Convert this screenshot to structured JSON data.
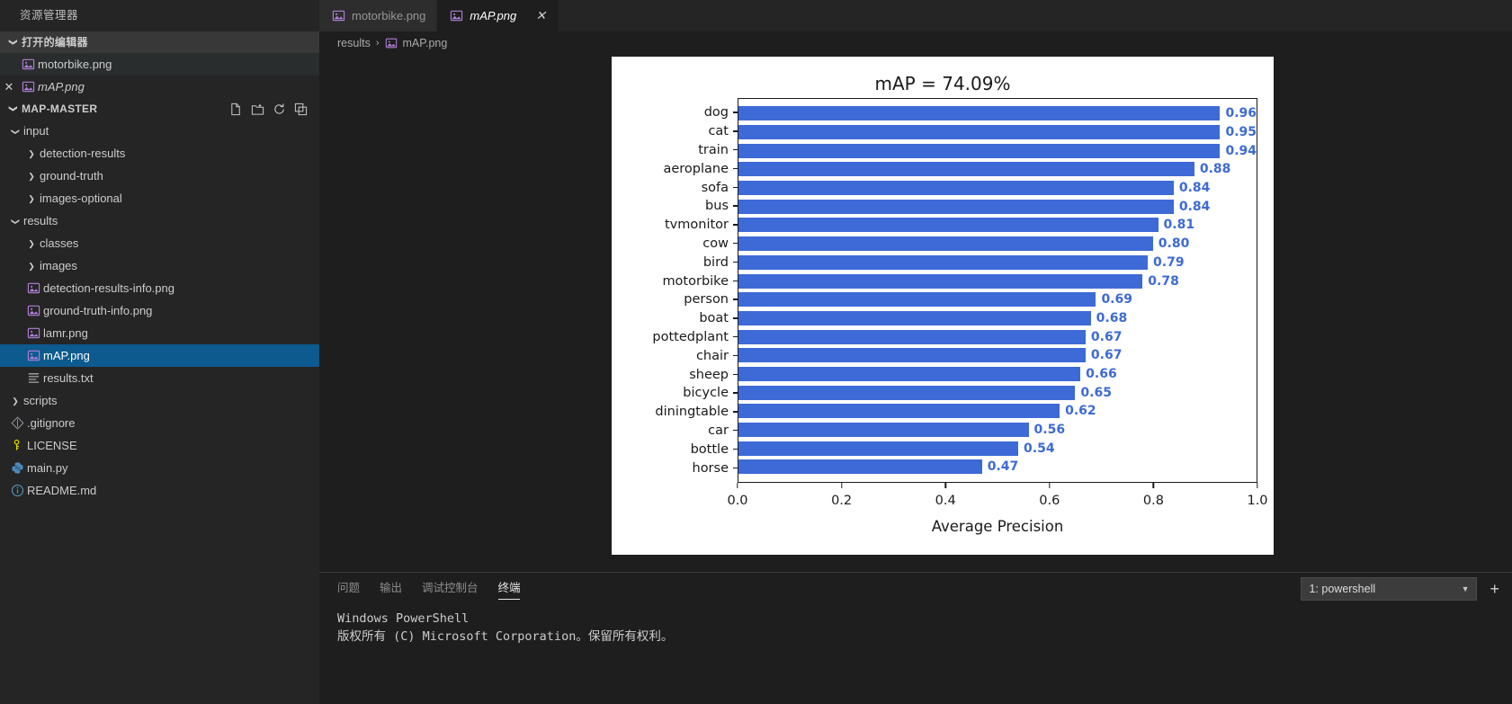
{
  "sidebar": {
    "title": "资源管理器",
    "open_editors": {
      "label": "打开的编辑器",
      "items": [
        {
          "name": "motorbike.png",
          "icon": "image-file-icon",
          "closable": false
        },
        {
          "name": "mAP.png",
          "icon": "image-file-icon",
          "closable": true,
          "active": true
        }
      ]
    },
    "project": {
      "label": "MAP-MASTER",
      "actions": [
        "new-file-icon",
        "new-folder-icon",
        "refresh-icon",
        "collapse-all-icon"
      ],
      "tree": [
        {
          "label": "input",
          "type": "folder",
          "state": "expanded",
          "depth": 1
        },
        {
          "label": "detection-results",
          "type": "folder",
          "state": "collapsed",
          "depth": 2
        },
        {
          "label": "ground-truth",
          "type": "folder",
          "state": "collapsed",
          "depth": 2
        },
        {
          "label": "images-optional",
          "type": "folder",
          "state": "collapsed",
          "depth": 2
        },
        {
          "label": "results",
          "type": "folder",
          "state": "expanded",
          "depth": 1
        },
        {
          "label": "classes",
          "type": "folder",
          "state": "collapsed",
          "depth": 2
        },
        {
          "label": "images",
          "type": "folder",
          "state": "collapsed",
          "depth": 2
        },
        {
          "label": "detection-results-info.png",
          "type": "image",
          "depth": 2
        },
        {
          "label": "ground-truth-info.png",
          "type": "image",
          "depth": 2
        },
        {
          "label": "lamr.png",
          "type": "image",
          "depth": 2
        },
        {
          "label": "mAP.png",
          "type": "image",
          "depth": 2,
          "selected": true
        },
        {
          "label": "results.txt",
          "type": "text",
          "depth": 2
        },
        {
          "label": "scripts",
          "type": "folder",
          "state": "collapsed",
          "depth": 1
        },
        {
          "label": ".gitignore",
          "type": "git",
          "depth": 1
        },
        {
          "label": "LICENSE",
          "type": "license",
          "depth": 1
        },
        {
          "label": "main.py",
          "type": "python",
          "depth": 1
        },
        {
          "label": "README.md",
          "type": "info",
          "depth": 1
        }
      ]
    }
  },
  "tabs": [
    {
      "label": "motorbike.png",
      "active": false,
      "closable": false
    },
    {
      "label": "mAP.png",
      "active": true,
      "closable": true
    }
  ],
  "breadcrumb": {
    "parts": [
      "results",
      "mAP.png"
    ],
    "separator": "›"
  },
  "chart_data": {
    "type": "bar",
    "orientation": "horizontal",
    "title": "mAP = 74.09%",
    "xlabel": "Average Precision",
    "ylabel": "",
    "xlim": [
      0.0,
      1.0
    ],
    "xticks": [
      0.0,
      0.2,
      0.4,
      0.6,
      0.8,
      1.0
    ],
    "xticklabels": [
      "0.0",
      "0.2",
      "0.4",
      "0.6",
      "0.8",
      "1.0"
    ],
    "grid": false,
    "legend": null,
    "bar_color": "#3d6ad6",
    "label_color": "#3d6ad6",
    "categories": [
      "dog",
      "cat",
      "train",
      "aeroplane",
      "sofa",
      "bus",
      "tvmonitor",
      "cow",
      "bird",
      "motorbike",
      "person",
      "boat",
      "pottedplant",
      "chair",
      "sheep",
      "bicycle",
      "diningtable",
      "car",
      "bottle",
      "horse"
    ],
    "values": [
      0.96,
      0.95,
      0.94,
      0.88,
      0.84,
      0.84,
      0.81,
      0.8,
      0.79,
      0.78,
      0.69,
      0.68,
      0.67,
      0.67,
      0.66,
      0.65,
      0.62,
      0.56,
      0.54,
      0.47
    ],
    "value_labels": [
      "0.96",
      "0.95",
      "0.94",
      "0.88",
      "0.84",
      "0.84",
      "0.81",
      "0.80",
      "0.79",
      "0.78",
      "0.69",
      "0.68",
      "0.67",
      "0.67",
      "0.66",
      "0.65",
      "0.62",
      "0.56",
      "0.54",
      "0.47"
    ]
  },
  "panel": {
    "tabs": [
      {
        "label": "问题",
        "active": false
      },
      {
        "label": "输出",
        "active": false
      },
      {
        "label": "调试控制台",
        "active": false
      },
      {
        "label": "终端",
        "active": true
      }
    ],
    "terminal_select": "1: powershell",
    "new_terminal": "+",
    "lines": [
      "Windows PowerShell",
      "版权所有 (C) Microsoft Corporation。保留所有权利。"
    ]
  }
}
